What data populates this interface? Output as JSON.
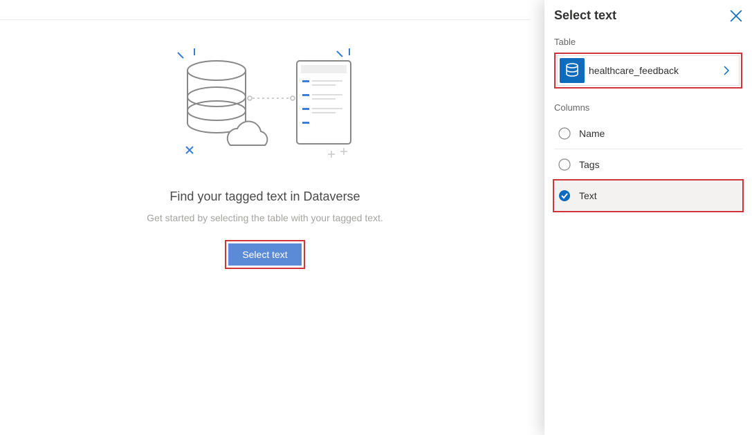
{
  "main": {
    "title": "Find your tagged text in Dataverse",
    "subtitle": "Get started by selecting the table with your tagged text.",
    "select_button": "Select text"
  },
  "panel": {
    "title": "Select text",
    "table_label": "Table",
    "table_name": "healthcare_feedback",
    "columns_label": "Columns",
    "columns": [
      {
        "label": "Name",
        "selected": false
      },
      {
        "label": "Tags",
        "selected": false
      },
      {
        "label": "Text",
        "selected": true
      }
    ]
  }
}
